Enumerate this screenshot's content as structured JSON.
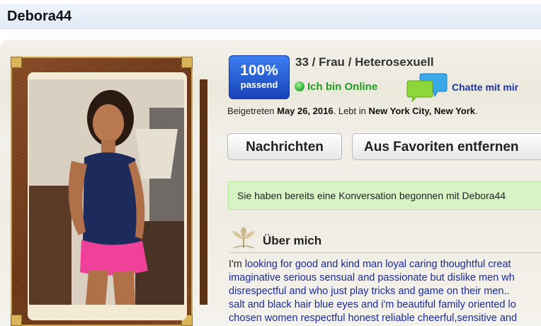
{
  "header": {
    "username": "Debora44"
  },
  "profile": {
    "match_badge": {
      "percent": "100%",
      "label": "passend"
    },
    "demographics": "33 / Frau / Heterosexuell",
    "online_status": "Ich bin Online",
    "chat_label": "Chatte mit mir",
    "joined": {
      "prefix": "Beigetreten ",
      "date": "May 26, 2016",
      "middle": ". Lebt in ",
      "location": "New York City, New York",
      "suffix": "."
    }
  },
  "actions": {
    "messages_label": "Nachrichten",
    "favorites_label": "Aus Favoriten entfernen"
  },
  "notice": "Sie haben bereits eine Konversation begonnen mit Debora44",
  "about": {
    "heading": "Über mich",
    "lines": [
      {
        "lead": "I'm ",
        "text": "looking for good and kind man loyal caring thoughtful creat"
      },
      {
        "lead": "",
        "text": "imaginative serious sensual and passionate but dislike men wh"
      },
      {
        "lead": "",
        "text": "disrespectful and who just play tricks and game on their men.."
      },
      {
        "lead": "",
        "text": "salt and black hair blue eyes and i'm beautiful family oriented lo"
      },
      {
        "lead": "",
        "text": "chosen women respectful honest reliable cheerful,sensitive and"
      }
    ]
  },
  "colors": {
    "online_green": "#1f9d1f",
    "link_blue": "#1a33a8",
    "badge_blue": "#1743b8",
    "notice_bg": "#d7f5c4"
  }
}
